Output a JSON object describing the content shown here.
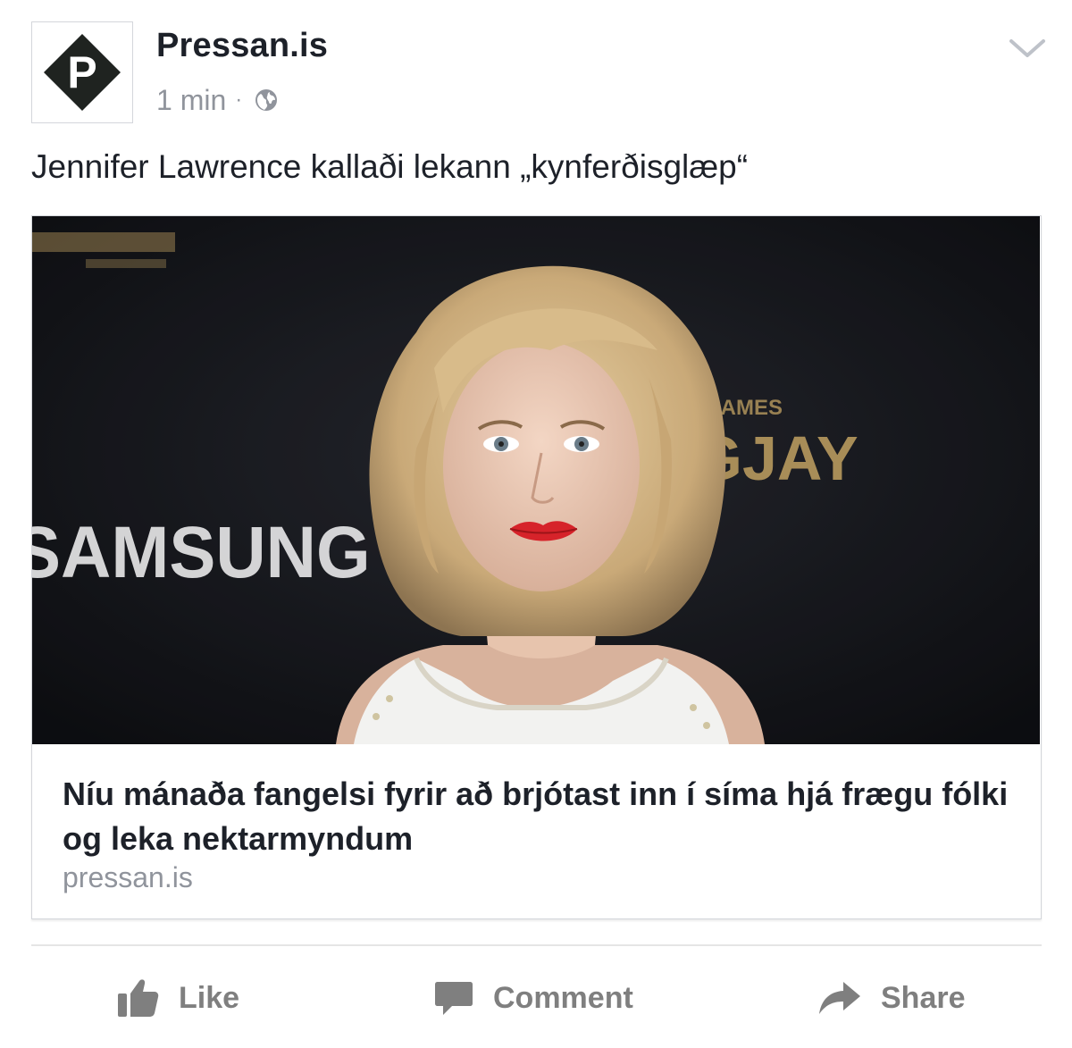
{
  "post": {
    "page_name": "Pressan.is",
    "timestamp": "1 min",
    "separator": "·",
    "audience_icon": "globe-icon",
    "menu_icon": "chevron-down-icon",
    "text": "Jennifer Lawrence kallaði lekann „kynferðisglæp“"
  },
  "avatar": {
    "logo_letter": "P",
    "logo_color": "#1f2320"
  },
  "link_preview": {
    "image_backdrop_text": [
      "SAMSUNG",
      "NGJAY",
      "ER GAMES"
    ],
    "title": "Níu mánaða fangelsi fyrir að brjótast inn í síma hjá frægu fólki og leka nektarmyndum",
    "domain": "pressan.is"
  },
  "actions": {
    "like": "Like",
    "comment": "Comment",
    "share": "Share"
  },
  "colors": {
    "text_primary": "#1d2129",
    "text_secondary": "#90949c",
    "action_gray": "#7f7f7f",
    "border": "#d4d6db"
  }
}
